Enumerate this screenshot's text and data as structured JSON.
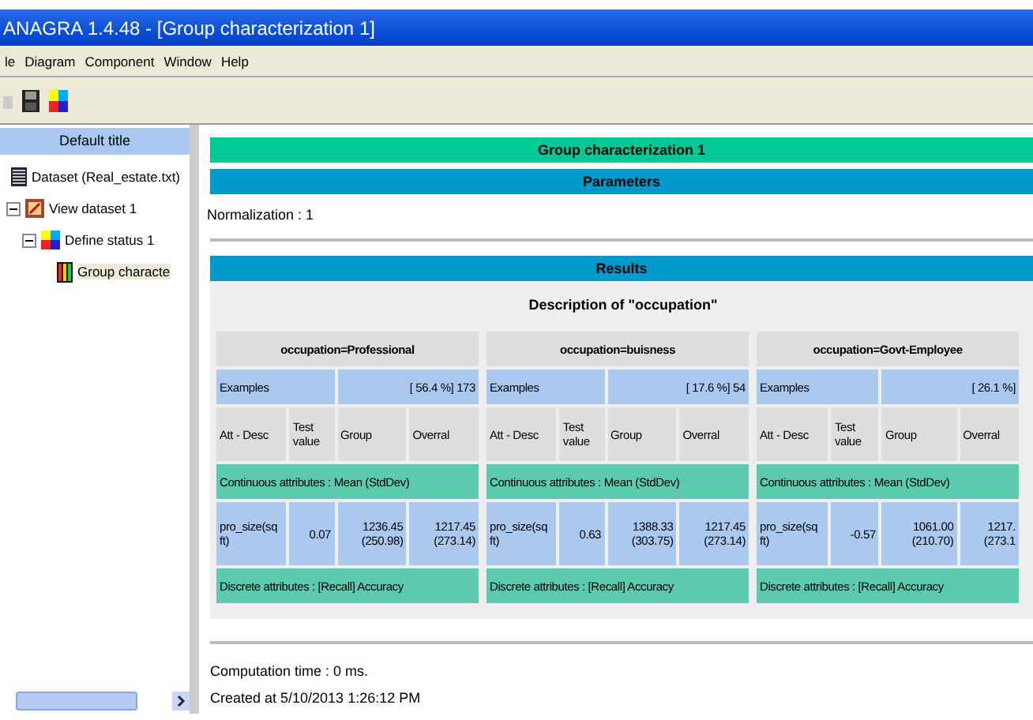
{
  "window": {
    "title": "ANAGRA 1.4.48 - [Group characterization 1]"
  },
  "menu": [
    {
      "label": "le"
    },
    {
      "label": "Diagram"
    },
    {
      "label": "Component"
    },
    {
      "label": "Window"
    },
    {
      "label": "Help"
    }
  ],
  "tree": {
    "title": "Default title",
    "nodes": [
      {
        "label": "Dataset (Real_estate.txt)",
        "kind": "dataset",
        "selected": false
      },
      {
        "label": "View dataset 1",
        "kind": "view",
        "selected": false,
        "expanded": true,
        "children": [
          {
            "label": "Define status 1",
            "kind": "status",
            "selected": false,
            "expanded": true,
            "children": [
              {
                "label": "Group characte",
                "kind": "chart",
                "selected": true
              }
            ]
          }
        ]
      }
    ]
  },
  "report": {
    "title": "Group characterization 1",
    "parameters_header": "Parameters",
    "parameters": "Normalization : 1",
    "results_header": "Results",
    "description": "Description of \"occupation\"",
    "groups": [
      {
        "name": "occupation=Professional",
        "examples_label": "Examples",
        "examples_value": "[ 56.4 %] 173",
        "columns": [
          "Att - Desc",
          "Test value",
          "Group",
          "Overral"
        ],
        "continuous": "Continuous attributes : Mean (StdDev)",
        "rows": [
          {
            "attribute": "pro_size(sq ft)",
            "test_value": "0.07",
            "group": "1236.45 (250.98)",
            "overall": "1217.45 (273.14)"
          }
        ],
        "discrete": "Discrete attributes : [Recall] Accuracy"
      },
      {
        "name": "occupation=buisness",
        "examples_label": "Examples",
        "examples_value": "[ 17.6 %] 54",
        "columns": [
          "Att - Desc",
          "Test value",
          "Group",
          "Overral"
        ],
        "continuous": "Continuous attributes : Mean (StdDev)",
        "rows": [
          {
            "attribute": "pro_size(sq ft)",
            "test_value": "0.63",
            "group": "1388.33 (303.75)",
            "overall": "1217.45 (273.14)"
          }
        ],
        "discrete": "Discrete attributes : [Recall] Accuracy"
      },
      {
        "name": "occupation=Govt-Employee",
        "examples_label": "Examples",
        "examples_value": "[ 26.1 %]",
        "columns": [
          "Att - Desc",
          "Test value",
          "Group",
          "Overral"
        ],
        "continuous": "Continuous attributes : Mean (StdDev)",
        "rows": [
          {
            "attribute": "pro_size(sq ft)",
            "test_value": "-0.57",
            "group": "1061.00 (210.70)",
            "overall": "1217. (273.1"
          }
        ],
        "discrete": "Discrete attributes : [Recall] Accuracy"
      }
    ],
    "computation": "Computation time : 0 ms.",
    "created": "Created at 5/10/2013 1:26:12 PM"
  }
}
